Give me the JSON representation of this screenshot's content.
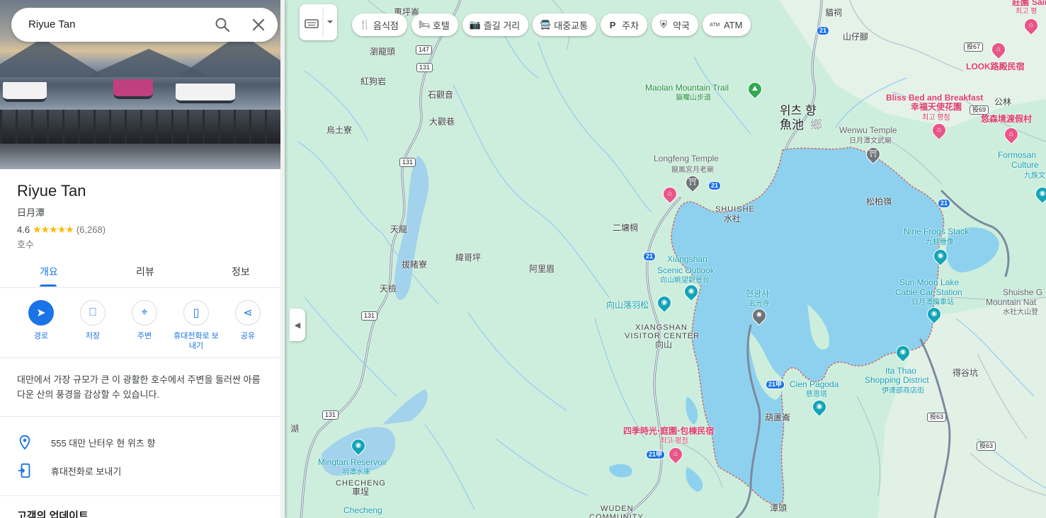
{
  "search": {
    "query": "Riyue Tan"
  },
  "place": {
    "title": "Riyue Tan",
    "native_name": "日月潭",
    "rating": "4.6",
    "review_count": "(6,268)",
    "category": "호수",
    "description": "대만에서 가장 규모가 큰 이 광활한 호수에서 주변을 둘러싼 아름다운 산의 풍경을 감상할 수 있습니다."
  },
  "tabs": [
    {
      "label": "개요"
    },
    {
      "label": "리뷰"
    },
    {
      "label": "정보"
    }
  ],
  "actions": [
    {
      "label": "경로",
      "icon": "directions-icon"
    },
    {
      "label": "저장",
      "icon": "bookmark-icon"
    },
    {
      "label": "주변",
      "icon": "nearby-icon"
    },
    {
      "label": "휴대전화로 보내기",
      "icon": "send-to-phone-icon"
    },
    {
      "label": "공유",
      "icon": "share-icon"
    }
  ],
  "info": {
    "address": "555 대만 난터우 현 위츠 향",
    "send_to_phone": "휴대전화로 보내기"
  },
  "updates_heading": "고객의 업데이트",
  "chips": [
    {
      "label": "음식점",
      "icon": "restaurant-icon"
    },
    {
      "label": "호텔",
      "icon": "hotel-icon"
    },
    {
      "label": "즐길 거리",
      "icon": "camera-icon"
    },
    {
      "label": "대중교통",
      "icon": "transit-icon"
    },
    {
      "label": "주차",
      "icon": "parking-icon"
    },
    {
      "label": "약국",
      "icon": "pharmacy-icon"
    },
    {
      "label": "ATM",
      "icon": "atm-icon"
    }
  ],
  "map_labels": {
    "yuchi_kr": "위츠 향",
    "yuchi_cn": "魚池",
    "yuchi_suffix": "鄉",
    "maolan": "Maolan Mountain Trail",
    "maolan_cn": "貓囒山步道",
    "longfeng": "Longfeng Temple",
    "longfeng_cn": "龍鳳宮月老廟",
    "shuishe": "SHUISHE",
    "shuishe_cn": "水社",
    "xiangshan_outlook": "Xiangshan Scenic Outlook",
    "xiangshan_outlook_cn": "向山眺望觀景台",
    "xuanguang": "현광사",
    "xuanguang_cn": "玄光寺",
    "xiangshan_feather": "向山落羽松",
    "xiangshan_vc": "XIANGSHAN VISITOR CENTER",
    "xiangshan_cn": "向山",
    "nine_frogs": "Nine Frogs Stack",
    "nine_frogs_cn": "九蛙疊像",
    "cable_car": "Sun Moon Lake Cable Car Station",
    "cable_car_cn": "日月潭纜車站",
    "ita_thao": "Ita Thao Shopping District",
    "ita_thao_cn": "伊達邵商店街",
    "cien": "Cien Pagoda",
    "cien_cn": "慈恩塔",
    "wenwu": "Wenwu Temple",
    "wenwu_cn": "日月潭文武廟",
    "bliss": "Bliss Bed and Breakfast",
    "bliss_cn": "幸福天使花園",
    "bliss_rate": "최고 평점",
    "youlin": "悠森境渡假村",
    "look": "LOOK路殿民宿",
    "formosan": "Formosan Culture",
    "formosan_cn": "九族文",
    "saint": "Saint P",
    "saint_cn": "莊園",
    "saint_rate": "최고 평",
    "shuishe_trail": "Shuishe G Mountain Nat",
    "shuishe_trail_cn": "水社大山登",
    "sijishiguang": "四季時光‧庭園‧包棟民宿",
    "sijishiguang_rate": "최고 평점",
    "mingtan": "Mingtan Reservoir",
    "mingtan_cn": "明潭水庫",
    "checheng": "CHECHENG",
    "checheng_cn": "車埕",
    "checheng_station": "Checheng",
    "wuden": "WUDEN COMMUNITY",
    "chexingkeng": "車坪崙",
    "liulongtou": "瀏龍頭",
    "hongguyan": "紅狗岩",
    "shiguanyin": "石觀音",
    "daguanxiang": "大觀巷",
    "wutuliao": "烏土寮",
    "tianlong": "天龍",
    "bazengliao": "拔睹寮",
    "tianjian": "天檢",
    "xiangepeng": "緯哥坪",
    "alimei": "阿里眉",
    "erpangpeng": "二墉棡",
    "shanzijiao": "山仔腳",
    "maoci": "貓祠",
    "songbailing": "松柏嶺",
    "hulukeng": "葫蘆崙",
    "degukeng": "得谷坑",
    "gongling": "公林",
    "tantou": "潭頭",
    "hu": "湖"
  },
  "routes": [
    "147",
    "131",
    "131",
    "131",
    "131",
    "21",
    "21",
    "21",
    "21甲",
    "21甲",
    "21",
    "投67",
    "投69",
    "投63",
    "投63"
  ]
}
